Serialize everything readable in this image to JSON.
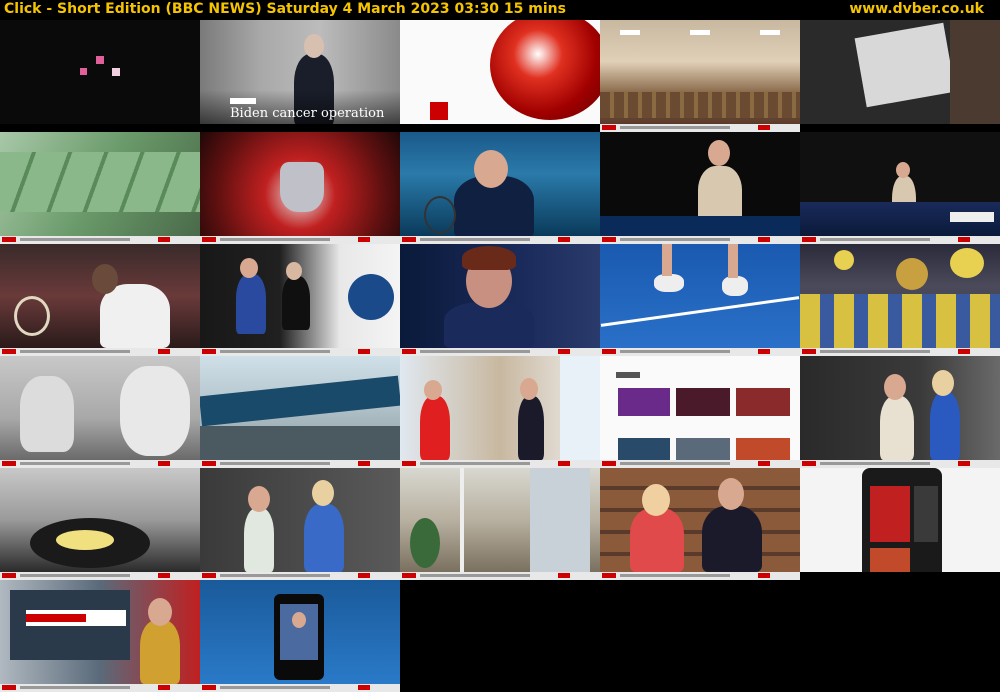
{
  "header": {
    "title": "Click - Short Edition (BBC NEWS)    Saturday 4 March 2023  03:30  15 mins",
    "site": "www.dvber.co.uk"
  },
  "frames": [
    {
      "caption": ""
    },
    {
      "caption": "Biden cancer operation"
    }
  ],
  "colors": {
    "accent": "#f5c400",
    "bbc_red": "#c00000"
  }
}
